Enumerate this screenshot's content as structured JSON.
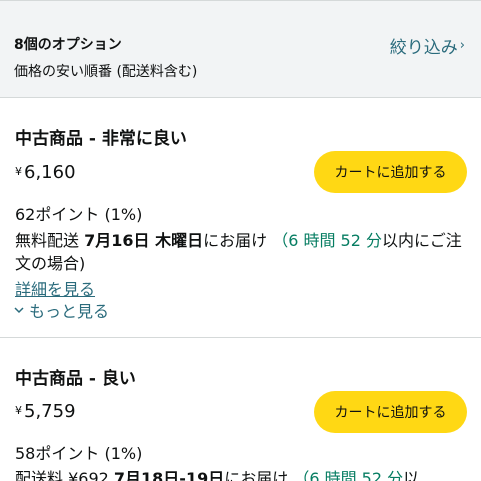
{
  "header": {
    "count": "8個のオプション",
    "sort": "価格の安い順番 (配送料含む)",
    "filter_label": "絞り込み",
    "filter_chevron": "›"
  },
  "offers": [
    {
      "condition": "中古商品 - 非常に良い",
      "currency": "¥",
      "price": "6,160",
      "cart_label": "カートに追加する",
      "points": "62ポイント (1%)",
      "shipping": "無料配送",
      "date": "7月16日 木曜日",
      "arrive": "にお届け",
      "countdown": "（6 時間 52 分",
      "deadline": "以内にご注文の場合)",
      "details": "詳細を見る",
      "more": "もっと見る"
    },
    {
      "condition": "中古商品 - 良い",
      "currency": "¥",
      "price": "5,759",
      "cart_label": "カートに追加する",
      "points": "58ポイント (1%)",
      "shipping": "配送料 ¥692",
      "date": "7月18日-19日",
      "arrive": "にお届け",
      "countdown": "（6 時間 52 分",
      "deadline": "以"
    }
  ],
  "colors": {
    "link": "#2a6b7c",
    "button": "#ffd814",
    "countdown": "#067d62"
  }
}
